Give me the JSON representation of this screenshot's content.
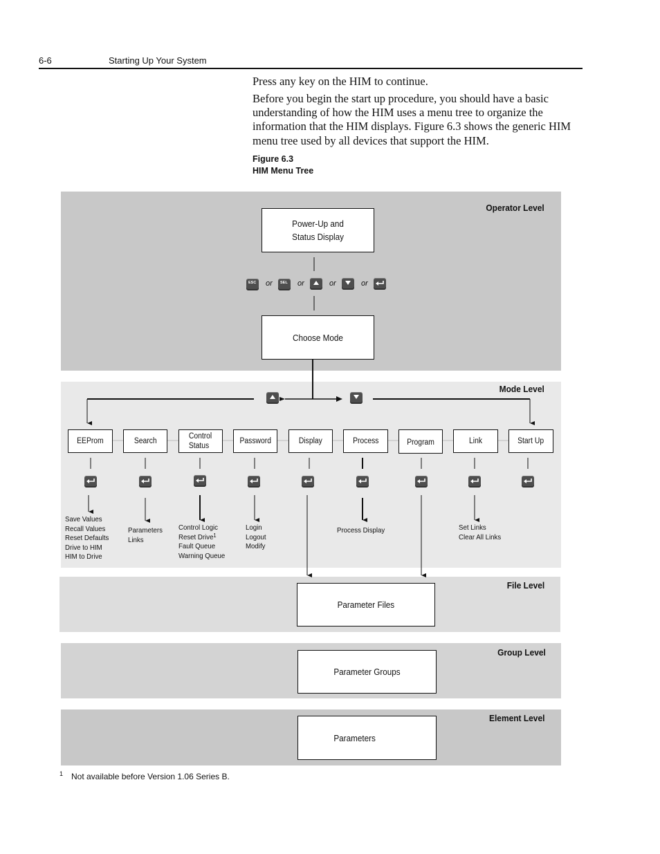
{
  "page_header": {
    "page_number": "6-6",
    "section_title": "Starting Up Your System"
  },
  "body": {
    "paragraph_1": "Press any key on the HIM to continue.",
    "paragraph_2": "Before you begin the start up procedure, you should have a basic understanding of how the HIM uses a menu tree to organize the information that the HIM displays. Figure 6.3 shows the generic HIM menu tree used by all devices that support the HIM."
  },
  "figure": {
    "number": "Figure 6.3",
    "title": "HIM Menu Tree",
    "levels": {
      "operator": "Operator Level",
      "mode": "Mode Level",
      "file": "File Level",
      "group": "Group Level",
      "element": "Element Level"
    },
    "operator": {
      "power_up_box": "Power-Up and\nStatus Display",
      "choose_mode_box": "Choose Mode",
      "keys": [
        {
          "icon": "esc-key-icon",
          "label": "ESC"
        },
        {
          "icon": "sel-key-icon",
          "label": "SEL"
        },
        {
          "icon": "up-arrow-key-icon",
          "label": "▲"
        },
        {
          "icon": "down-arrow-key-icon",
          "label": "▼"
        },
        {
          "icon": "enter-key-icon",
          "label": "↵"
        }
      ],
      "or_text": "or"
    },
    "mode_keys": [
      {
        "icon": "up-arrow-key-icon",
        "label": "▲"
      },
      {
        "icon": "down-arrow-key-icon",
        "label": "▼"
      }
    ],
    "modes": [
      {
        "label": "EEProm",
        "options": [
          "Save Values",
          "Recall Values",
          "Reset Defaults",
          "Drive to HIM",
          "HIM to Drive"
        ]
      },
      {
        "label": "Search",
        "options": [
          "Parameters",
          "Links"
        ]
      },
      {
        "label": "Control\nStatus",
        "options": [
          "Control Logic",
          "Reset Drive",
          "Fault Queue",
          "Warning Queue"
        ],
        "footnote_on": "Reset Drive",
        "footnote_ref": "1"
      },
      {
        "label": "Password",
        "options": [
          "Login",
          "Logout",
          "Modify"
        ]
      },
      {
        "label": "Display",
        "options": []
      },
      {
        "label": "Process",
        "options": [
          "Process Display"
        ]
      },
      {
        "label": "Program",
        "options": []
      },
      {
        "label": "Link",
        "options": [
          "Set Links",
          "Clear All Links"
        ]
      },
      {
        "label": "Start Up",
        "options": []
      }
    ],
    "file_box": "Parameter Files",
    "group_box": "Parameter Groups",
    "element_box": "Parameters",
    "colors": {
      "operator_band": "#c8c8c8",
      "mode_band": "#e9e9e9",
      "file_band": "#dddddd",
      "group_band": "#d3d3d3",
      "element_band": "#c8c8c8",
      "key_fill": "#4e4e4e"
    }
  },
  "footnote": {
    "mark": "1",
    "text": "Not available before Version 1.06 Series B."
  }
}
